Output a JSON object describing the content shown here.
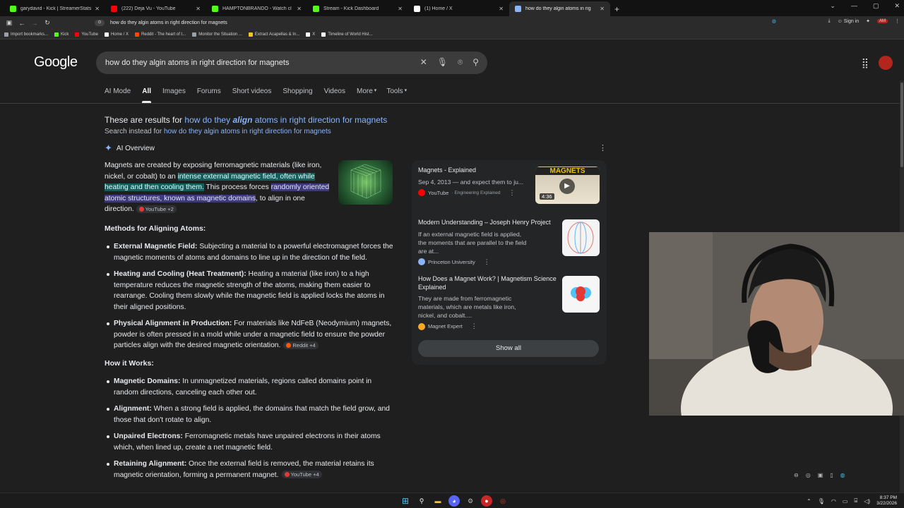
{
  "browser": {
    "tabs": [
      {
        "title": "garydavid - Kick | StreamerStats",
        "color": "#53fc18",
        "active": false
      },
      {
        "title": "(222) Deja Vu - YouTube",
        "color": "#ff0000",
        "active": false
      },
      {
        "title": "HAMPTONBRANDO - Watch cl",
        "color": "#53fc18",
        "active": false
      },
      {
        "title": "Stream - Kick Dashboard",
        "color": "#53fc18",
        "active": false
      },
      {
        "title": "(1) Home / X",
        "color": "#ffffff",
        "active": false
      },
      {
        "title": "how do they algin atoms in rig",
        "color": "#8ab4f8",
        "active": true
      }
    ],
    "new_tab": "+",
    "url": "how do they algin atoms in right direction for magnets",
    "sign_in": "Sign in",
    "bookmarks": [
      {
        "label": "Import bookmarks...",
        "color": "#9aa0a6"
      },
      {
        "label": "Kick",
        "color": "#53fc18"
      },
      {
        "label": "YouTube",
        "color": "#ff0000"
      },
      {
        "label": "Home / X",
        "color": "#ffffff"
      },
      {
        "label": "Reddit - The heart of t...",
        "color": "#ff4500"
      },
      {
        "label": "Monitor the Situation ...",
        "color": "#9aa0a6"
      },
      {
        "label": "Extract Acapellas & In...",
        "color": "#f5c518"
      },
      {
        "label": "X",
        "color": "#ffffff"
      },
      {
        "label": "Timeline of World Hist...",
        "color": "#ffffff"
      }
    ]
  },
  "search": {
    "logo": "Google",
    "query": "how do they algin atoms in right direction for magnets",
    "nav": [
      "AI Mode",
      "All",
      "Images",
      "Forums",
      "Short videos",
      "Shopping",
      "Videos",
      "More",
      "Tools"
    ],
    "selected_nav": "All",
    "correction_prefix": "These are results for ",
    "correction_pre": "how do they ",
    "correction_bold": "align",
    "correction_post": " atoms in right direction for magnets",
    "instead_prefix": "Search instead for ",
    "instead_link": "how do they algin atoms in right direction for magnets"
  },
  "ai_overview": {
    "label": "AI Overview",
    "intro": {
      "t1": "Magnets are created by exposing ferromagnetic materials (like iron, nickel, or cobalt) to an ",
      "h1": "intense external magnetic field, often while heating and then cooling them.",
      "t2": " This process forces ",
      "h2": "randomly oriented atomic structures, known as magnetic domains",
      "t3": ", to align in one direction.",
      "chip": "YouTube +2"
    },
    "methods_heading": "Methods for Aligning Atoms:",
    "methods": [
      {
        "title": "External Magnetic Field:",
        "text": " Subjecting a material to a powerful electromagnet forces the magnetic moments of atoms and domains to line up in the direction of the field.",
        "chip": ""
      },
      {
        "title": "Heating and Cooling (Heat Treatment):",
        "text": " Heating a material (like iron) to a high temperature reduces the magnetic strength of the atoms, making them easier to rearrange. Cooling them slowly while the magnetic field is applied locks the atoms in their aligned positions.",
        "chip": ""
      },
      {
        "title": "Physical Alignment in Production:",
        "text": " For materials like NdFeB (Neodymium) magnets, powder is often pressed in a mold while under a magnetic field to ensure the powder particles align with the desired magnetic orientation.",
        "chip": "Reddit +4"
      }
    ],
    "how_heading": "How it Works:",
    "how": [
      {
        "title": "Magnetic Domains:",
        "text": " In unmagnetized materials, regions called domains point in random directions, canceling each other out.",
        "chip": ""
      },
      {
        "title": "Alignment:",
        "text": " When a strong field is applied, the domains that match the field grow, and those that don't rotate to align.",
        "chip": ""
      },
      {
        "title": "Unpaired Electrons:",
        "text": " Ferromagnetic metals have unpaired electrons in their atoms which, when lined up, create a net magnetic field.",
        "chip": ""
      },
      {
        "title": "Retaining Alignment:",
        "text": " Once the external field is removed, the material retains its magnetic orientation, forming a permanent magnet.",
        "chip": "YouTube +4"
      }
    ]
  },
  "sources": [
    {
      "title": "Magnets - Explained",
      "snippet": "Sep 4, 2013 — and expect them to ju...",
      "brand": "YouTube",
      "brand_sub": " · Engineering Explained",
      "brand_color": "#ff0000",
      "thumb_label": "MAGNETS",
      "duration": "4:36"
    },
    {
      "title": "Modern Understanding – Joseph Henry Project",
      "snippet": "If an external magnetic field is applied, the moments that are parallel to the field are at...",
      "brand": "Princeton University",
      "brand_sub": "",
      "brand_color": "#8ab4f8"
    },
    {
      "title": "How Does a Magnet Work? | Magnetism Science Explained",
      "snippet": "They are made from ferromagnetic materials, which are metals like iron, nickel, and cobalt....",
      "brand": "Magnet Expert",
      "brand_sub": "",
      "brand_color": "#f9a825"
    }
  ],
  "show_all": "Show all",
  "taskbar": {
    "time": "8:37 PM",
    "date": "3/22/2026"
  }
}
